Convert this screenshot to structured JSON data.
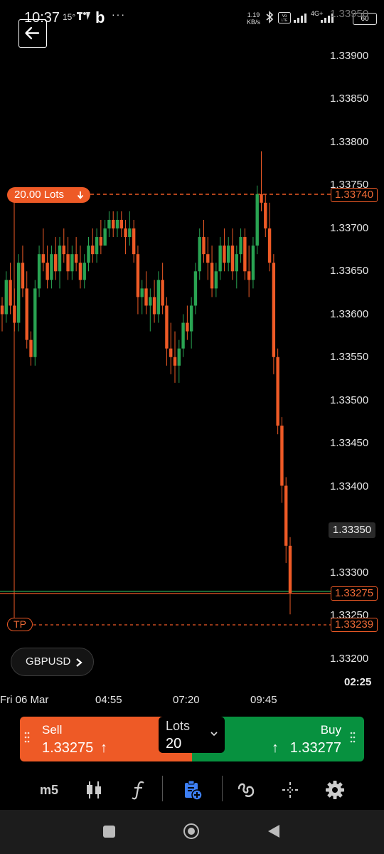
{
  "status_bar": {
    "time": "10:37",
    "temp": "15°",
    "app_letter": "b",
    "more": "···",
    "net_speed_value": "1.19",
    "net_speed_unit": "KB/s",
    "network": "4G+",
    "battery": "60"
  },
  "chart": {
    "y_axis_labels": [
      "1.33950",
      "1.33900",
      "1.33850",
      "1.33800",
      "1.33750",
      "1.33700",
      "1.33650",
      "1.33600",
      "1.33550",
      "1.33500",
      "1.33450",
      "1.33400",
      "1.33350",
      "1.33300",
      "1.33250",
      "1.33200"
    ],
    "x_axis_labels": [
      "Fri 06 Mar",
      "04:55",
      "07:20",
      "09:45"
    ],
    "current_price": "1.33350",
    "order_line_price": "1.33740",
    "bid_line_price": "1.33275",
    "tp_price": "1.33239",
    "order_lots_label": "20.00 Lots",
    "tp_label": "TP",
    "timer": "02:25",
    "symbol": "GBPUSD"
  },
  "chart_data": {
    "type": "candlestick",
    "ylim": [
      1.332,
      1.3397
    ],
    "candles": [
      [
        1.3361,
        1.3362,
        1.3358,
        1.336
      ],
      [
        1.336,
        1.3365,
        1.3359,
        1.3364
      ],
      [
        1.3364,
        1.3366,
        1.336,
        1.3361
      ],
      [
        1.3361,
        1.3363,
        1.3358,
        1.3359
      ],
      [
        1.3359,
        1.3367,
        1.3358,
        1.3366
      ],
      [
        1.3366,
        1.3368,
        1.3362,
        1.3363
      ],
      [
        1.3363,
        1.3365,
        1.3356,
        1.3357
      ],
      [
        1.3357,
        1.3358,
        1.3354,
        1.3355
      ],
      [
        1.3355,
        1.3364,
        1.3354,
        1.3363
      ],
      [
        1.3363,
        1.3368,
        1.3362,
        1.3367
      ],
      [
        1.3367,
        1.337,
        1.3365,
        1.3366
      ],
      [
        1.3366,
        1.3368,
        1.3363,
        1.3364
      ],
      [
        1.3364,
        1.3368,
        1.3363,
        1.3367
      ],
      [
        1.3367,
        1.3369,
        1.3364,
        1.3365
      ],
      [
        1.3365,
        1.3369,
        1.3363,
        1.3368
      ],
      [
        1.3368,
        1.337,
        1.3366,
        1.3367
      ],
      [
        1.3367,
        1.3369,
        1.3364,
        1.3365
      ],
      [
        1.3365,
        1.3368,
        1.3364,
        1.3367
      ],
      [
        1.3367,
        1.3369,
        1.3365,
        1.3366
      ],
      [
        1.3366,
        1.3368,
        1.3363,
        1.3364
      ],
      [
        1.3364,
        1.3367,
        1.3363,
        1.3366
      ],
      [
        1.3366,
        1.3369,
        1.3365,
        1.3368
      ],
      [
        1.3368,
        1.337,
        1.3366,
        1.3367
      ],
      [
        1.3367,
        1.337,
        1.3366,
        1.3369
      ],
      [
        1.3369,
        1.3371,
        1.3367,
        1.3368
      ],
      [
        1.3368,
        1.3371,
        1.3368,
        1.337
      ],
      [
        1.337,
        1.3372,
        1.3369,
        1.3371
      ],
      [
        1.3371,
        1.3372,
        1.3369,
        1.337
      ],
      [
        1.337,
        1.3372,
        1.3369,
        1.3371
      ],
      [
        1.3371,
        1.3372,
        1.3369,
        1.337
      ],
      [
        1.337,
        1.3371,
        1.3367,
        1.3369
      ],
      [
        1.3369,
        1.3372,
        1.3368,
        1.337
      ],
      [
        1.337,
        1.3371,
        1.3366,
        1.3367
      ],
      [
        1.3367,
        1.3368,
        1.336,
        1.3362
      ],
      [
        1.3362,
        1.3364,
        1.336,
        1.3363
      ],
      [
        1.3363,
        1.3365,
        1.336,
        1.3361
      ],
      [
        1.3361,
        1.3363,
        1.3358,
        1.3362
      ],
      [
        1.3362,
        1.3364,
        1.3359,
        1.336
      ],
      [
        1.336,
        1.3365,
        1.3359,
        1.3364
      ],
      [
        1.3364,
        1.3366,
        1.336,
        1.3361
      ],
      [
        1.3361,
        1.3362,
        1.3354,
        1.3356
      ],
      [
        1.3356,
        1.3359,
        1.3353,
        1.3355
      ],
      [
        1.3355,
        1.3358,
        1.3352,
        1.3354
      ],
      [
        1.3354,
        1.3357,
        1.3352,
        1.3356
      ],
      [
        1.3356,
        1.336,
        1.3355,
        1.3359
      ],
      [
        1.3359,
        1.3361,
        1.3357,
        1.3358
      ],
      [
        1.3358,
        1.3362,
        1.3356,
        1.3361
      ],
      [
        1.3361,
        1.3366,
        1.336,
        1.3365
      ],
      [
        1.3365,
        1.337,
        1.3364,
        1.3369
      ],
      [
        1.3369,
        1.3371,
        1.3366,
        1.3367
      ],
      [
        1.3367,
        1.3369,
        1.3364,
        1.3366
      ],
      [
        1.3366,
        1.3368,
        1.3362,
        1.3363
      ],
      [
        1.3363,
        1.3366,
        1.3362,
        1.3365
      ],
      [
        1.3365,
        1.3369,
        1.3364,
        1.3368
      ],
      [
        1.3368,
        1.337,
        1.3365,
        1.3366
      ],
      [
        1.3366,
        1.3369,
        1.3365,
        1.3368
      ],
      [
        1.3368,
        1.337,
        1.3364,
        1.3365
      ],
      [
        1.3365,
        1.3368,
        1.3363,
        1.3367
      ],
      [
        1.3367,
        1.337,
        1.3366,
        1.3369
      ],
      [
        1.3369,
        1.337,
        1.3364,
        1.3365
      ],
      [
        1.3365,
        1.3368,
        1.3362,
        1.3364
      ],
      [
        1.3364,
        1.3369,
        1.3363,
        1.3368
      ],
      [
        1.3368,
        1.3375,
        1.3367,
        1.3374
      ],
      [
        1.3374,
        1.3379,
        1.3372,
        1.3373
      ],
      [
        1.3373,
        1.3374,
        1.3369,
        1.337
      ],
      [
        1.337,
        1.3373,
        1.3365,
        1.3366
      ],
      [
        1.3366,
        1.3367,
        1.3353,
        1.3355
      ],
      [
        1.3355,
        1.3356,
        1.3346,
        1.3347
      ],
      [
        1.3347,
        1.3348,
        1.3338,
        1.334
      ],
      [
        1.334,
        1.3341,
        1.3331,
        1.3333
      ],
      [
        1.3333,
        1.3334,
        1.3325,
        1.33275
      ]
    ]
  },
  "trade": {
    "sell_label": "Sell",
    "sell_price": "1.33275",
    "buy_label": "Buy",
    "buy_price": "1.33277",
    "lots_label": "Lots",
    "lots_value": "20",
    "up_arrow": "↑"
  },
  "toolbar": {
    "timeframe": "m5"
  },
  "colors": {
    "sell": "#ee5a26",
    "buy": "#07913f",
    "bull": "#29a352",
    "bear": "#ee5a26"
  }
}
